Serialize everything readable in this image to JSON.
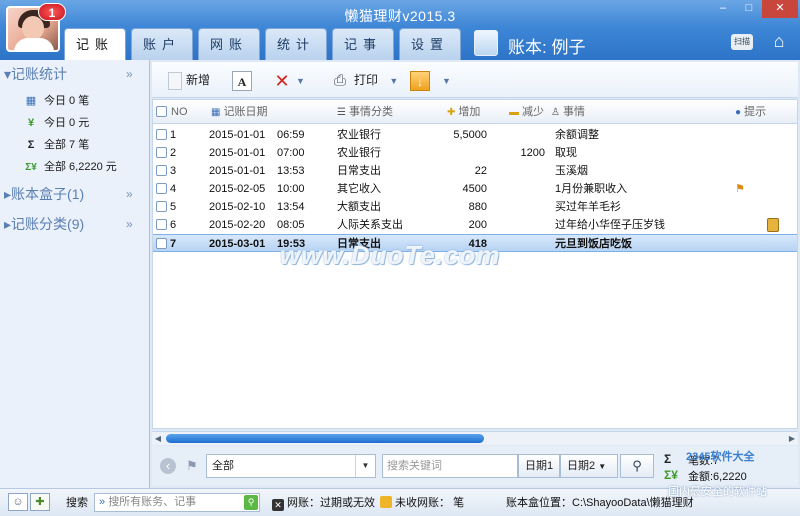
{
  "app": {
    "title": "懒猫理财v2015.3",
    "notification_count": "1",
    "book_label": "账本: 例子"
  },
  "window_controls": {
    "min": "–",
    "max": "□",
    "close": "✕"
  },
  "tabs": [
    {
      "label": "记账"
    },
    {
      "label": "账户"
    },
    {
      "label": "网账"
    },
    {
      "label": "统计"
    },
    {
      "label": "记事"
    },
    {
      "label": "设置"
    }
  ],
  "top_icons": {
    "ocr_label": "扫描",
    "home_icon": "home-icon"
  },
  "sidebar": {
    "stats_title": "记账统计",
    "stats_items": [
      {
        "icon": "calendar-icon",
        "glyph": "▦",
        "label": "今日 0 笔"
      },
      {
        "icon": "yen-icon",
        "glyph": "¥",
        "label": "今日 0 元"
      },
      {
        "icon": "sum-icon",
        "glyph": "Σ",
        "label": "全部 7 笔"
      },
      {
        "icon": "sum-yen-icon",
        "glyph": "Σ¥",
        "label": "全部 6,2220 元"
      }
    ],
    "box_title": "账本盒子(1)",
    "category_title": "记账分类(9)",
    "collapse_glyph": "»"
  },
  "toolbar": {
    "new_label": "新增",
    "print_label": "打印"
  },
  "table": {
    "headers": {
      "no": "NO",
      "date": "记账日期",
      "category": "事情分类",
      "increase": "增加",
      "decrease": "减少",
      "matter": "事情",
      "reminder": "提示"
    },
    "rows": [
      {
        "no": "1",
        "date": "2015-01-01",
        "time": "06:59",
        "category": "农业银行",
        "increase": "5,5000",
        "decrease": "",
        "matter": "余额调整",
        "icon": ""
      },
      {
        "no": "2",
        "date": "2015-01-01",
        "time": "07:00",
        "category": "农业银行",
        "increase": "",
        "decrease": "1200",
        "matter": "取现",
        "icon": ""
      },
      {
        "no": "3",
        "date": "2015-01-01",
        "time": "13:53",
        "category": "日常支出",
        "increase": "22",
        "decrease": "",
        "matter": "玉溪烟",
        "icon": ""
      },
      {
        "no": "4",
        "date": "2015-02-05",
        "time": "10:00",
        "category": "其它收入",
        "increase": "4500",
        "decrease": "",
        "matter": "1月份兼职收入",
        "icon": "flag"
      },
      {
        "no": "5",
        "date": "2015-02-10",
        "time": "13:54",
        "category": "大额支出",
        "increase": "880",
        "decrease": "",
        "matter": "买过年羊毛衫",
        "icon": ""
      },
      {
        "no": "6",
        "date": "2015-02-20",
        "time": "08:05",
        "category": "人际关系支出",
        "increase": "200",
        "decrease": "",
        "matter": "过年给小华侄子压岁钱",
        "icon": "note"
      },
      {
        "no": "7",
        "date": "2015-03-01",
        "time": "19:53",
        "category": "日常支出",
        "increase": "418",
        "decrease": "",
        "matter": "元旦到饭店吃饭",
        "icon": ""
      }
    ],
    "selected_row": 7
  },
  "watermark": "www.DuoTe.com",
  "filter": {
    "scope_value": "全部",
    "search_placeholder": "搜索关键词",
    "date1_label": "日期1",
    "date2_label": "日期2",
    "count_label": "笔数:7",
    "amount_label": "金额:6,2220"
  },
  "status": {
    "search_label": "搜索",
    "search_placeholder": "搜所有账务、记事",
    "netbill_label": "网账：过期或无效",
    "unreceived_label": "未收网账：",
    "unreceived_unit": "笔",
    "location_label": "账本盒位置：C:\\ShayooData\\懒猫理财",
    "watermark2": "2345软件大全",
    "watermark3": "国内最安全的软件站"
  },
  "colors": {
    "title_bar": "#3e86d6",
    "selected_row": "#b7d3f3",
    "sidebar_head": "#5a7fb3",
    "close_button": "#c9463d"
  }
}
